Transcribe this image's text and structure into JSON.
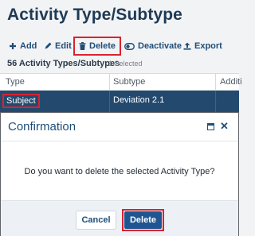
{
  "page": {
    "title": "Activity Type/Subtype"
  },
  "toolbar": {
    "add_label": "Add",
    "edit_label": "Edit",
    "delete_label": "Delete",
    "deactivate_label": "Deactivate",
    "export_label": "Export"
  },
  "list": {
    "count_label": "56 Activity Types/Subtypes",
    "selected_label": "1 Selected"
  },
  "grid": {
    "columns": [
      "Type",
      "Subtype",
      "Additi"
    ],
    "selected_row": {
      "type": "Subject",
      "subtype": "Deviation 2.1"
    }
  },
  "dialog": {
    "title": "Confirmation",
    "message": "Do you want to delete the selected Activity Type?",
    "cancel_label": "Cancel",
    "confirm_label": "Delete"
  },
  "colors": {
    "accent": "#1f4e79",
    "highlight": "#d9232e",
    "selected_row": "#234a6e",
    "primary_button": "#1f5692"
  }
}
